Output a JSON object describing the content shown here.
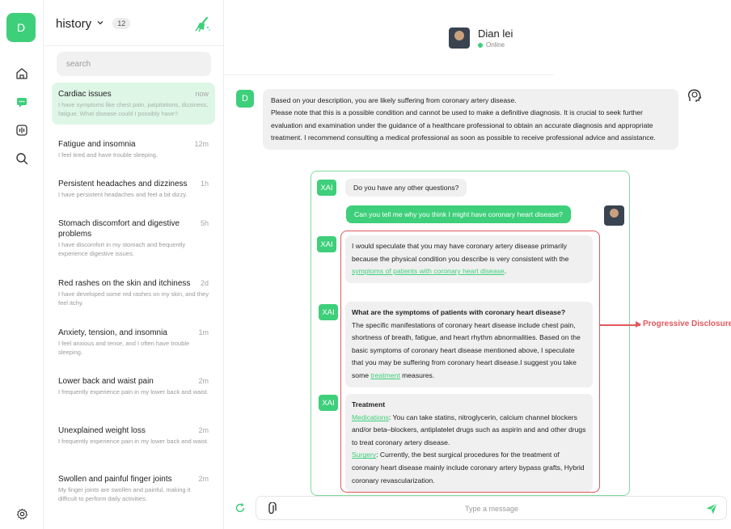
{
  "rail": {
    "avatar_letter": "D",
    "icons": [
      "home-icon",
      "chat-icon",
      "voice-icon",
      "search-icon",
      "settings-icon"
    ]
  },
  "history": {
    "title": "history",
    "count": "12",
    "search_placeholder": "search",
    "items": [
      {
        "title": "Cardiac issues",
        "time": "now",
        "desc": "I have symptoms like chest pain, palpitations, dizziness, fatigue. What disease could I possibly have?"
      },
      {
        "title": "Fatigue and insomnia",
        "time": "12m",
        "desc": "I feel tired and have trouble sleeping."
      },
      {
        "title": "Persistent headaches and dizziness",
        "time": "1h",
        "desc": "I have persistent headaches and feel a bit dizzy."
      },
      {
        "title": "Stomach discomfort and digestive problems",
        "time": "5h",
        "desc": "I have discomfort in my stomach and frequently experience digestive issues."
      },
      {
        "title": "Red rashes on the skin and itchiness",
        "time": "2d",
        "desc": "I have developed some red rashes on my skin, and they feel itchy."
      },
      {
        "title": "Anxiety, tension, and insomnia",
        "time": "1m",
        "desc": "I feel anxious and tense, and I often have trouble sleeping."
      },
      {
        "title": "Lower back and waist pain",
        "time": "2m",
        "desc": "I frequently experience pain in my lower back and waist."
      },
      {
        "title": "Unexplained weight loss",
        "time": "2m",
        "desc": "I frequently experience pain in my lower back and waist."
      },
      {
        "title": "Swollen and painful finger joints",
        "time": "2m",
        "desc": "My finger joints are swollen and painful, making it difficult to perform daily activities."
      }
    ]
  },
  "chat": {
    "contact_name": "Dian lei",
    "contact_status": "Online",
    "assistant_letter": "D",
    "first_message": {
      "line1": "Based on your description, you are likely suffering from coronary artery disease.",
      "line2": "Please note that this is a possible condition and cannot be used to make a definitive diagnosis. It is crucial to seek further evaluation and examination under the guidance of a healthcare professional to obtain an accurate diagnosis and appropriate treatment. I recommend consulting a medical professional as soon as possible to receive professional advice and assistance."
    },
    "xai_label": "XAI",
    "xai_question": "Do you have any other questions?",
    "user_question": "Can you tell me why you think I might have coronary heart disease?",
    "answer1": {
      "text": "I would speculate that you may have coronary artery disease primarily because the physical condition you describe is very consistent with the ",
      "link": "symptoms of patients with coronary heart disease",
      "end": "."
    },
    "answer2": {
      "heading": "What are the symptoms of patients with coronary heart disease?",
      "text": "The specific manifestations of coronary heart disease include chest pain, shortness of breath, fatigue, and heart rhythm abnormalities. Based on the basic symptoms of coronary heart disease mentioned above, I speculate that you may be suffering from coronary heart disease.I suggest you take some ",
      "link": "treatment",
      "end": " measures."
    },
    "answer3": {
      "heading": "Treatment",
      "link1": "Medications",
      "text1": ": You can take statins, nitroglycerin, calcium channel blockers and/or beta–blockers, antiplatelet drugs such as aspirin and and other drugs to treat coronary artery disease.",
      "link2": "Surgery",
      "text2": ": Currently, the best surgical procedures for the treatment of coronary heart disease mainly include coronary artery bypass grafts, Hybrid coronary revascularization."
    },
    "annotation": "Progressive Disclosure",
    "input_placeholder": "Type a message"
  },
  "colors": {
    "accent": "#3ecf7a",
    "annotation": "#e0585c",
    "bubble": "#f0f0f0"
  }
}
